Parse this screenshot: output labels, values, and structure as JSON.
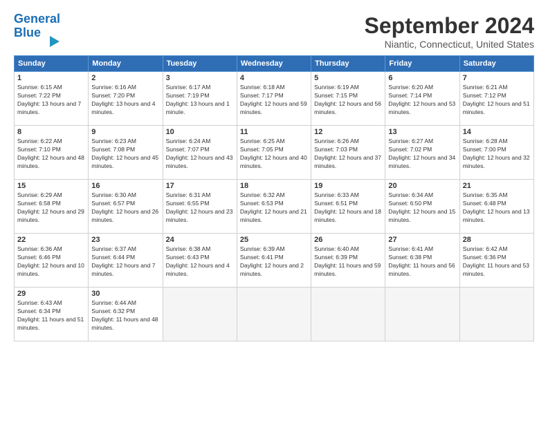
{
  "header": {
    "logo_line1": "General",
    "logo_line2": "Blue",
    "month": "September 2024",
    "location": "Niantic, Connecticut, United States"
  },
  "weekdays": [
    "Sunday",
    "Monday",
    "Tuesday",
    "Wednesday",
    "Thursday",
    "Friday",
    "Saturday"
  ],
  "weeks": [
    [
      {
        "day": "1",
        "sunrise": "Sunrise: 6:15 AM",
        "sunset": "Sunset: 7:22 PM",
        "daylight": "Daylight: 13 hours and 7 minutes."
      },
      {
        "day": "2",
        "sunrise": "Sunrise: 6:16 AM",
        "sunset": "Sunset: 7:20 PM",
        "daylight": "Daylight: 13 hours and 4 minutes."
      },
      {
        "day": "3",
        "sunrise": "Sunrise: 6:17 AM",
        "sunset": "Sunset: 7:19 PM",
        "daylight": "Daylight: 13 hours and 1 minute."
      },
      {
        "day": "4",
        "sunrise": "Sunrise: 6:18 AM",
        "sunset": "Sunset: 7:17 PM",
        "daylight": "Daylight: 12 hours and 59 minutes."
      },
      {
        "day": "5",
        "sunrise": "Sunrise: 6:19 AM",
        "sunset": "Sunset: 7:15 PM",
        "daylight": "Daylight: 12 hours and 56 minutes."
      },
      {
        "day": "6",
        "sunrise": "Sunrise: 6:20 AM",
        "sunset": "Sunset: 7:14 PM",
        "daylight": "Daylight: 12 hours and 53 minutes."
      },
      {
        "day": "7",
        "sunrise": "Sunrise: 6:21 AM",
        "sunset": "Sunset: 7:12 PM",
        "daylight": "Daylight: 12 hours and 51 minutes."
      }
    ],
    [
      {
        "day": "8",
        "sunrise": "Sunrise: 6:22 AM",
        "sunset": "Sunset: 7:10 PM",
        "daylight": "Daylight: 12 hours and 48 minutes."
      },
      {
        "day": "9",
        "sunrise": "Sunrise: 6:23 AM",
        "sunset": "Sunset: 7:08 PM",
        "daylight": "Daylight: 12 hours and 45 minutes."
      },
      {
        "day": "10",
        "sunrise": "Sunrise: 6:24 AM",
        "sunset": "Sunset: 7:07 PM",
        "daylight": "Daylight: 12 hours and 43 minutes."
      },
      {
        "day": "11",
        "sunrise": "Sunrise: 6:25 AM",
        "sunset": "Sunset: 7:05 PM",
        "daylight": "Daylight: 12 hours and 40 minutes."
      },
      {
        "day": "12",
        "sunrise": "Sunrise: 6:26 AM",
        "sunset": "Sunset: 7:03 PM",
        "daylight": "Daylight: 12 hours and 37 minutes."
      },
      {
        "day": "13",
        "sunrise": "Sunrise: 6:27 AM",
        "sunset": "Sunset: 7:02 PM",
        "daylight": "Daylight: 12 hours and 34 minutes."
      },
      {
        "day": "14",
        "sunrise": "Sunrise: 6:28 AM",
        "sunset": "Sunset: 7:00 PM",
        "daylight": "Daylight: 12 hours and 32 minutes."
      }
    ],
    [
      {
        "day": "15",
        "sunrise": "Sunrise: 6:29 AM",
        "sunset": "Sunset: 6:58 PM",
        "daylight": "Daylight: 12 hours and 29 minutes."
      },
      {
        "day": "16",
        "sunrise": "Sunrise: 6:30 AM",
        "sunset": "Sunset: 6:57 PM",
        "daylight": "Daylight: 12 hours and 26 minutes."
      },
      {
        "day": "17",
        "sunrise": "Sunrise: 6:31 AM",
        "sunset": "Sunset: 6:55 PM",
        "daylight": "Daylight: 12 hours and 23 minutes."
      },
      {
        "day": "18",
        "sunrise": "Sunrise: 6:32 AM",
        "sunset": "Sunset: 6:53 PM",
        "daylight": "Daylight: 12 hours and 21 minutes."
      },
      {
        "day": "19",
        "sunrise": "Sunrise: 6:33 AM",
        "sunset": "Sunset: 6:51 PM",
        "daylight": "Daylight: 12 hours and 18 minutes."
      },
      {
        "day": "20",
        "sunrise": "Sunrise: 6:34 AM",
        "sunset": "Sunset: 6:50 PM",
        "daylight": "Daylight: 12 hours and 15 minutes."
      },
      {
        "day": "21",
        "sunrise": "Sunrise: 6:35 AM",
        "sunset": "Sunset: 6:48 PM",
        "daylight": "Daylight: 12 hours and 13 minutes."
      }
    ],
    [
      {
        "day": "22",
        "sunrise": "Sunrise: 6:36 AM",
        "sunset": "Sunset: 6:46 PM",
        "daylight": "Daylight: 12 hours and 10 minutes."
      },
      {
        "day": "23",
        "sunrise": "Sunrise: 6:37 AM",
        "sunset": "Sunset: 6:44 PM",
        "daylight": "Daylight: 12 hours and 7 minutes."
      },
      {
        "day": "24",
        "sunrise": "Sunrise: 6:38 AM",
        "sunset": "Sunset: 6:43 PM",
        "daylight": "Daylight: 12 hours and 4 minutes."
      },
      {
        "day": "25",
        "sunrise": "Sunrise: 6:39 AM",
        "sunset": "Sunset: 6:41 PM",
        "daylight": "Daylight: 12 hours and 2 minutes."
      },
      {
        "day": "26",
        "sunrise": "Sunrise: 6:40 AM",
        "sunset": "Sunset: 6:39 PM",
        "daylight": "Daylight: 11 hours and 59 minutes."
      },
      {
        "day": "27",
        "sunrise": "Sunrise: 6:41 AM",
        "sunset": "Sunset: 6:38 PM",
        "daylight": "Daylight: 11 hours and 56 minutes."
      },
      {
        "day": "28",
        "sunrise": "Sunrise: 6:42 AM",
        "sunset": "Sunset: 6:36 PM",
        "daylight": "Daylight: 11 hours and 53 minutes."
      }
    ],
    [
      {
        "day": "29",
        "sunrise": "Sunrise: 6:43 AM",
        "sunset": "Sunset: 6:34 PM",
        "daylight": "Daylight: 11 hours and 51 minutes."
      },
      {
        "day": "30",
        "sunrise": "Sunrise: 6:44 AM",
        "sunset": "Sunset: 6:32 PM",
        "daylight": "Daylight: 11 hours and 48 minutes."
      },
      null,
      null,
      null,
      null,
      null
    ]
  ]
}
